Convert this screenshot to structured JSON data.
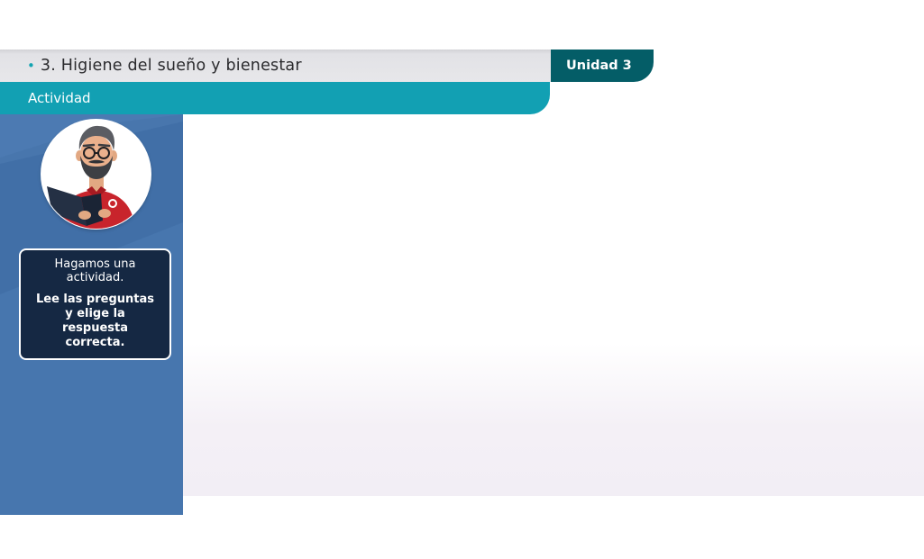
{
  "header": {
    "bullet": "•",
    "lesson_title": "3. Higiene del sueño y bienestar",
    "unit_label": "Unidad 3",
    "section_label": "Actividad"
  },
  "sidebar": {
    "avatar_icon": "teacher-reading-book-icon",
    "speech_intro": "Hagamos una actividad.",
    "speech_instruction": "Lee las preguntas y elige la respuesta correcta."
  },
  "colors": {
    "title_bar": "#e7e7ea",
    "unit_tab": "#045d67",
    "activity_bar": "#12a0b3",
    "sidebar": "#4776ae",
    "speech_box": "#152843",
    "accent_bullet": "#13a4b1"
  }
}
